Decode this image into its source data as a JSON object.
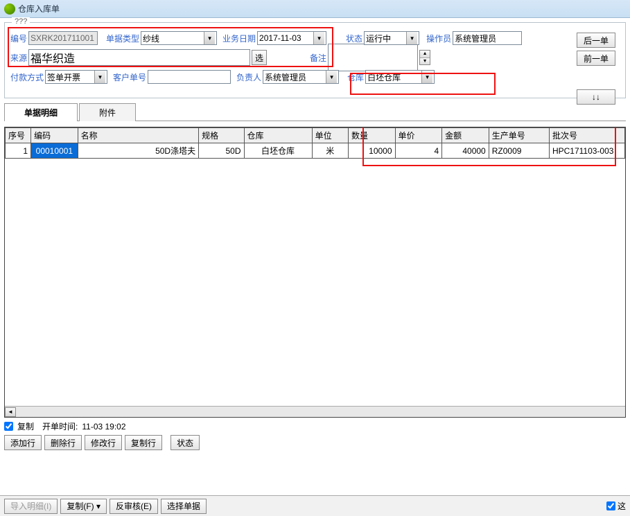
{
  "window": {
    "title": "仓库入库单"
  },
  "groupbox_label": "???",
  "form": {
    "code_label": "编号",
    "code_value": "SXRK201711001",
    "type_label": "单据类型",
    "type_value": "纱线",
    "date_label": "业务日期",
    "date_value": "2017-11-03",
    "status_label": "状态",
    "status_value": "运行中",
    "operator_label": "操作员",
    "operator_value": "系统管理员",
    "source_label": "来源",
    "source_value": "福华织造",
    "select_btn": "选",
    "remark_label": "备注",
    "pay_label": "付款方式",
    "pay_value": "签单开票",
    "custno_label": "客户单号",
    "custno_value": "",
    "owner_label": "负责人",
    "owner_value": "系统管理员",
    "wh_label": "仓库",
    "wh_value": "白坯仓库"
  },
  "side": {
    "next": "后一单",
    "prev": "前一单",
    "down": "↓↓"
  },
  "tabs": {
    "detail": "单据明细",
    "attach": "附件"
  },
  "grid": {
    "headers": [
      "序号",
      "编码",
      "名称",
      "规格",
      "仓库",
      "单位",
      "数量",
      "单价",
      "金额",
      "生产单号",
      "批次号"
    ],
    "row": {
      "seq": "1",
      "code": "00010001",
      "name": "50D涤塔夫",
      "spec": "50D",
      "wh": "白坯仓库",
      "unit": "米",
      "qty": "10000",
      "price": "4",
      "amount": "40000",
      "prod_no": "RZ0009",
      "batch": "HPC171103-003"
    }
  },
  "footer": {
    "copy_chk": "复制",
    "open_time_label": "开单时间:",
    "open_time_value": "11-03 19:02"
  },
  "actions": {
    "add": "添加行",
    "del": "删除行",
    "edit": "修改行",
    "copy": "复制行",
    "status": "状态"
  },
  "bottom": {
    "import": "导入明细(I)",
    "copy": "复制(F) ▾",
    "unapprove": "反审核(E)",
    "select": "选择单据",
    "right_chk": "这"
  }
}
